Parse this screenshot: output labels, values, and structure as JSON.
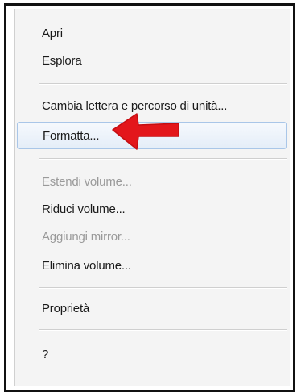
{
  "menu": {
    "items": [
      {
        "label": "Apri",
        "enabled": true
      },
      {
        "label": "Esplora",
        "enabled": true
      },
      {
        "label": "Cambia lettera e percorso di unità...",
        "enabled": true
      },
      {
        "label": "Formatta...",
        "enabled": true,
        "highlighted": true
      },
      {
        "label": "Estendi volume...",
        "enabled": false
      },
      {
        "label": "Riduci volume...",
        "enabled": true
      },
      {
        "label": "Aggiungi mirror...",
        "enabled": false
      },
      {
        "label": "Elimina volume...",
        "enabled": true
      },
      {
        "label": "Proprietà",
        "enabled": true
      },
      {
        "label": "?",
        "enabled": true
      }
    ]
  },
  "annotation": {
    "arrow_icon": "red-arrow-left-icon",
    "arrow_color": "#e3161b"
  },
  "colors": {
    "highlight_border": "#a9c6e8",
    "disabled_text": "#9a9a9a"
  }
}
